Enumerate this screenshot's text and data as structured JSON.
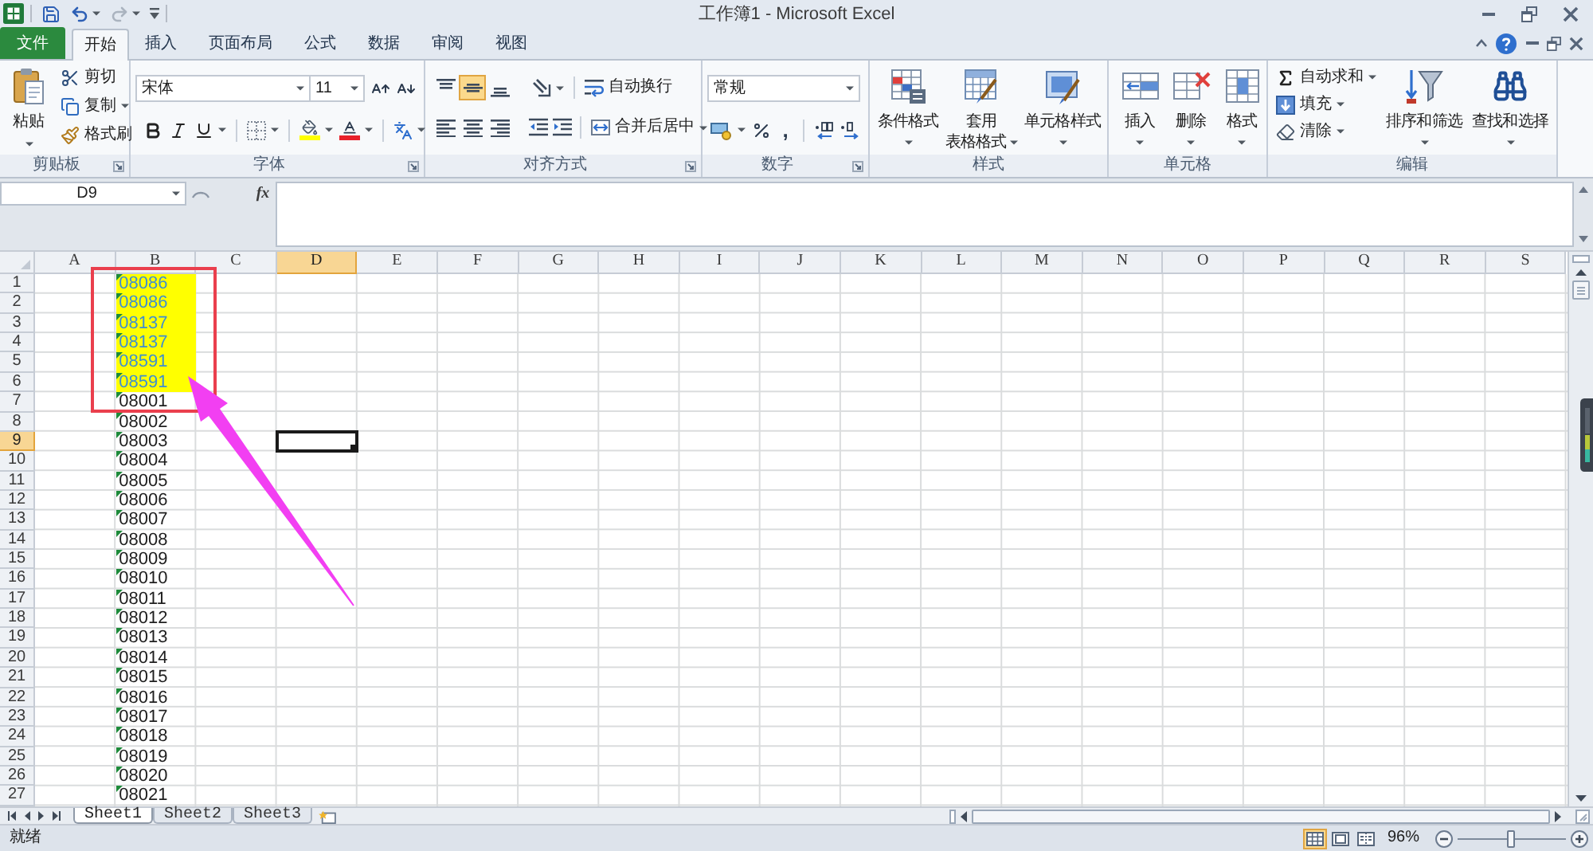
{
  "window": {
    "title": "工作簿1 - Microsoft Excel"
  },
  "quick_access": [
    {
      "kind": "save",
      "disabled": false
    },
    {
      "kind": "undo",
      "disabled": false
    },
    {
      "kind": "redo",
      "disabled": true
    },
    {
      "kind": "customize",
      "disabled": false
    }
  ],
  "file_tab": {
    "label": "文件"
  },
  "tabs": [
    {
      "label": "开始",
      "selected": true
    },
    {
      "label": "插入",
      "selected": false
    },
    {
      "label": "页面布局",
      "selected": false
    },
    {
      "label": "公式",
      "selected": false
    },
    {
      "label": "数据",
      "selected": false
    },
    {
      "label": "审阅",
      "selected": false
    },
    {
      "label": "视图",
      "selected": false
    }
  ],
  "ribbon": {
    "clipboard": {
      "label": "剪贴板",
      "paste": "粘贴",
      "cut": "剪切",
      "copy": "复制",
      "format_painter": "格式刷"
    },
    "font": {
      "label": "字体",
      "font_name": "宋体",
      "font_size": "11"
    },
    "alignment": {
      "label": "对齐方式",
      "vertical": [
        {
          "kind": "top",
          "selected": false
        },
        {
          "kind": "middle",
          "selected": true
        },
        {
          "kind": "bottom",
          "selected": false
        }
      ],
      "horizontal": [
        {
          "kind": "left",
          "selected": false
        },
        {
          "kind": "center",
          "selected": false
        },
        {
          "kind": "right",
          "selected": false
        }
      ],
      "wrap_text": "自动换行",
      "merge_center": "合并后居中"
    },
    "number": {
      "label": "数字",
      "format": "常规",
      "comma": ","
    },
    "styles": {
      "label": "样式",
      "conditional_formatting": "条件格式",
      "format_as_table": [
        "套用",
        "表格格式"
      ],
      "cell_styles": "单元格样式"
    },
    "cells": {
      "label": "单元格",
      "insert": "插入",
      "delete": "删除",
      "format": "格式"
    },
    "editing": {
      "label": "编辑",
      "autosum": "自动求和",
      "fill": "填充",
      "clear": "清除",
      "sort_filter": "排序和筛选",
      "find_select": "查找和选择"
    }
  },
  "formula_bar": {
    "name_box": "D9",
    "function_label": "fx"
  },
  "grid": {
    "columns": [
      {
        "label": "A",
        "selected": false
      },
      {
        "label": "B",
        "selected": false
      },
      {
        "label": "C",
        "selected": false
      },
      {
        "label": "D",
        "selected": true
      },
      {
        "label": "E",
        "selected": false
      },
      {
        "label": "F",
        "selected": false
      },
      {
        "label": "G",
        "selected": false
      },
      {
        "label": "H",
        "selected": false
      },
      {
        "label": "I",
        "selected": false
      },
      {
        "label": "J",
        "selected": false
      },
      {
        "label": "K",
        "selected": false
      },
      {
        "label": "L",
        "selected": false
      },
      {
        "label": "M",
        "selected": false
      },
      {
        "label": "N",
        "selected": false
      },
      {
        "label": "O",
        "selected": false
      },
      {
        "label": "P",
        "selected": false
      },
      {
        "label": "Q",
        "selected": false
      },
      {
        "label": "R",
        "selected": false
      },
      {
        "label": "S",
        "selected": false
      }
    ],
    "rows": [
      {
        "label": "1",
        "selected": false,
        "column_b": {
          "value": "08086",
          "highlighted": true,
          "flagged": true
        }
      },
      {
        "label": "2",
        "selected": false,
        "column_b": {
          "value": "08086",
          "highlighted": true,
          "flagged": true
        }
      },
      {
        "label": "3",
        "selected": false,
        "column_b": {
          "value": "08137",
          "highlighted": true,
          "flagged": true
        }
      },
      {
        "label": "4",
        "selected": false,
        "column_b": {
          "value": "08137",
          "highlighted": true,
          "flagged": true
        }
      },
      {
        "label": "5",
        "selected": false,
        "column_b": {
          "value": "08591",
          "highlighted": true,
          "flagged": true
        }
      },
      {
        "label": "6",
        "selected": false,
        "column_b": {
          "value": "08591",
          "highlighted": true,
          "flagged": true
        }
      },
      {
        "label": "7",
        "selected": false,
        "column_b": {
          "value": "08001",
          "highlighted": false,
          "flagged": true
        }
      },
      {
        "label": "8",
        "selected": false,
        "column_b": {
          "value": "08002",
          "highlighted": false,
          "flagged": true
        }
      },
      {
        "label": "9",
        "selected": true,
        "column_b": {
          "value": "08003",
          "highlighted": false,
          "flagged": true
        }
      },
      {
        "label": "10",
        "selected": false,
        "column_b": {
          "value": "08004",
          "highlighted": false,
          "flagged": true
        }
      },
      {
        "label": "11",
        "selected": false,
        "column_b": {
          "value": "08005",
          "highlighted": false,
          "flagged": true
        }
      },
      {
        "label": "12",
        "selected": false,
        "column_b": {
          "value": "08006",
          "highlighted": false,
          "flagged": true
        }
      },
      {
        "label": "13",
        "selected": false,
        "column_b": {
          "value": "08007",
          "highlighted": false,
          "flagged": true
        }
      },
      {
        "label": "14",
        "selected": false,
        "column_b": {
          "value": "08008",
          "highlighted": false,
          "flagged": true
        }
      },
      {
        "label": "15",
        "selected": false,
        "column_b": {
          "value": "08009",
          "highlighted": false,
          "flagged": true
        }
      },
      {
        "label": "16",
        "selected": false,
        "column_b": {
          "value": "08010",
          "highlighted": false,
          "flagged": true
        }
      },
      {
        "label": "17",
        "selected": false,
        "column_b": {
          "value": "08011",
          "highlighted": false,
          "flagged": true
        }
      },
      {
        "label": "18",
        "selected": false,
        "column_b": {
          "value": "08012",
          "highlighted": false,
          "flagged": true
        }
      },
      {
        "label": "19",
        "selected": false,
        "column_b": {
          "value": "08013",
          "highlighted": false,
          "flagged": true
        }
      },
      {
        "label": "20",
        "selected": false,
        "column_b": {
          "value": "08014",
          "highlighted": false,
          "flagged": true
        }
      },
      {
        "label": "21",
        "selected": false,
        "column_b": {
          "value": "08015",
          "highlighted": false,
          "flagged": true
        }
      },
      {
        "label": "22",
        "selected": false,
        "column_b": {
          "value": "08016",
          "highlighted": false,
          "flagged": true
        }
      },
      {
        "label": "23",
        "selected": false,
        "column_b": {
          "value": "08017",
          "highlighted": false,
          "flagged": true
        }
      },
      {
        "label": "24",
        "selected": false,
        "column_b": {
          "value": "08018",
          "highlighted": false,
          "flagged": true
        }
      },
      {
        "label": "25",
        "selected": false,
        "column_b": {
          "value": "08019",
          "highlighted": false,
          "flagged": true
        }
      },
      {
        "label": "26",
        "selected": false,
        "column_b": {
          "value": "08020",
          "highlighted": false,
          "flagged": true
        }
      },
      {
        "label": "27",
        "selected": false,
        "column_b": {
          "value": "08021",
          "highlighted": false,
          "flagged": true
        }
      }
    ]
  },
  "sheet_tabs": [
    {
      "label": "Sheet1",
      "selected": true
    },
    {
      "label": "Sheet2",
      "selected": false
    },
    {
      "label": "Sheet3",
      "selected": false
    }
  ],
  "status_bar": {
    "status": "就绪",
    "views": [
      {
        "kind": "normal",
        "selected": true
      },
      {
        "kind": "page_layout",
        "selected": false
      },
      {
        "kind": "page_break",
        "selected": false
      }
    ],
    "zoom": {
      "reading": "96%",
      "level": 0.48
    }
  }
}
